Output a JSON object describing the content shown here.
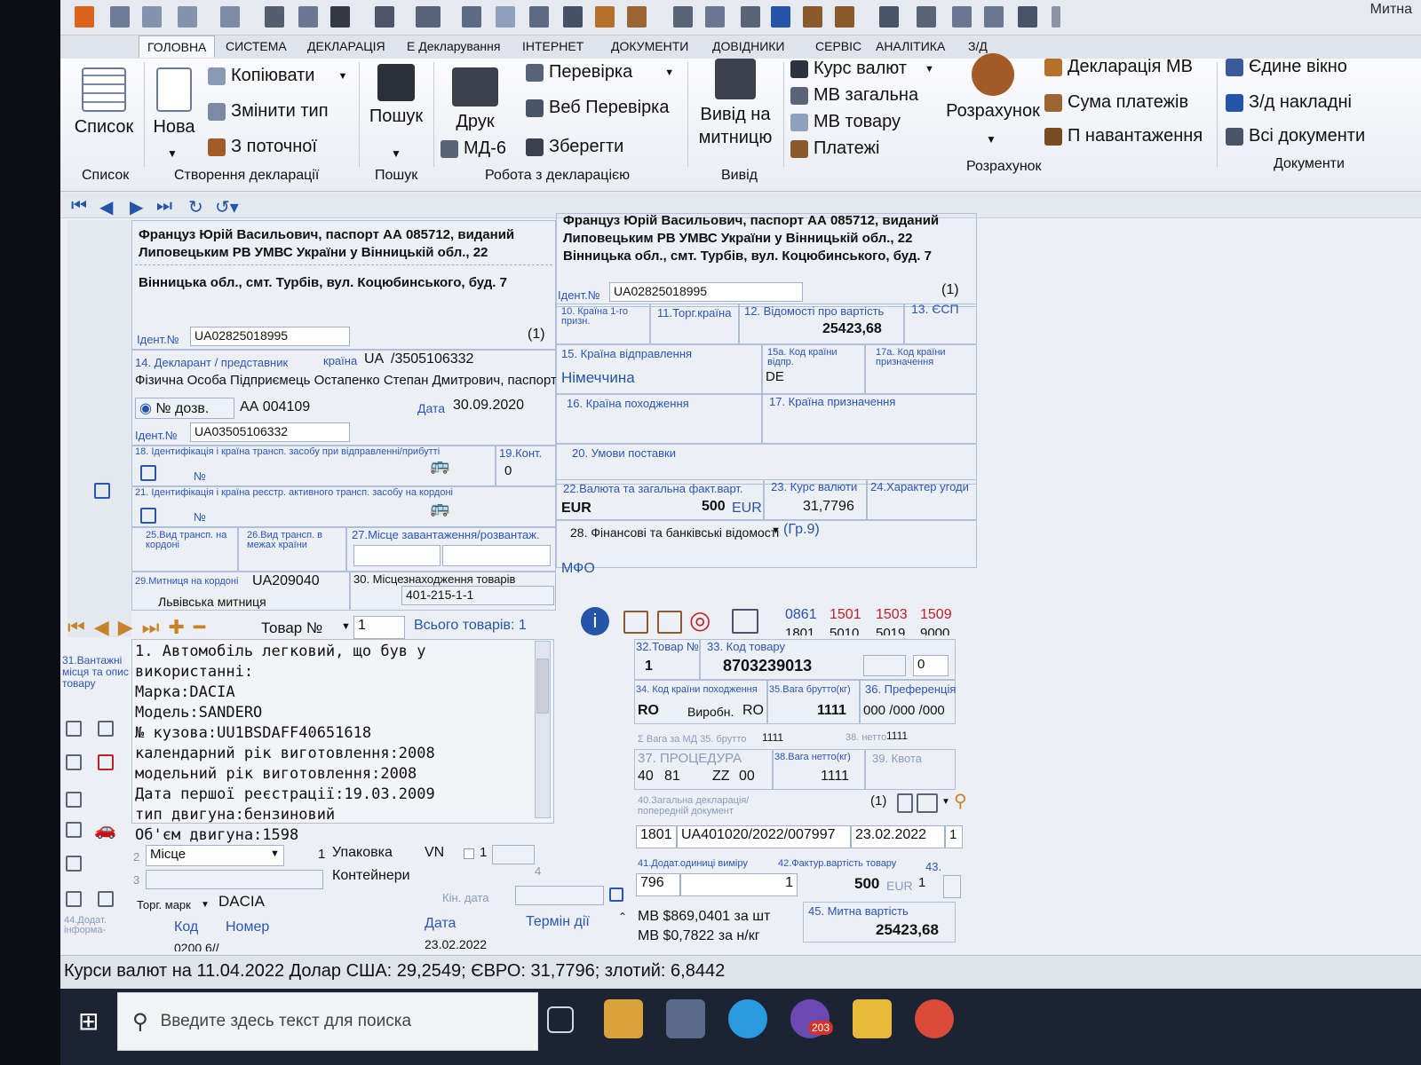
{
  "app": {
    "title": "Митна"
  },
  "menu": {
    "tabs": [
      "ГОЛОВНА",
      "СИСТЕМА",
      "ДЕКЛАРАЦІЯ",
      "Е Декларування",
      "ІНТЕРНЕТ",
      "ДОКУМЕНТИ",
      "ДОВІДНИКИ",
      "СЕРВІС",
      "АНАЛІТИКА",
      "З/Д"
    ]
  },
  "ribbon": {
    "list": {
      "button": "Список",
      "group": "Список"
    },
    "create": {
      "new": "Нова",
      "copy": "Копіювати",
      "change_type": "Змінити тип",
      "from_current": "З поточної",
      "group": "Створення декларації"
    },
    "search": {
      "button": "Пошук",
      "group": "Пошук"
    },
    "work": {
      "print": "Друк",
      "md6": "МД-6",
      "check": "Перевірка",
      "web_check": "Веб Перевірка",
      "save": "Зберегти",
      "group": "Робота з декларацією"
    },
    "output": {
      "button_line1": "Вивід на",
      "button_line2": "митницю",
      "group": "Вивід"
    },
    "calc": {
      "rates": "Курс валют",
      "mv_total": "МВ загальна",
      "mv_goods": "МВ товару",
      "payments": "Платежі",
      "calc_button": "Розрахунок",
      "decl_mv": "Декларація МВ",
      "sum_payments": "Сума платежів",
      "p_load": "П навантаження",
      "group": "Розрахунок"
    },
    "docs": {
      "single_window": "Єдине вікно",
      "zd_invoices": "З/д накладні",
      "all_docs": "Всі документи",
      "group": "Документи"
    }
  },
  "form": {
    "left_party": {
      "line1": "Француз Юрій Васильович, паспорт АА 085712, виданий",
      "line2": "Липовецьким РВ УМВС України у Вінницькій обл., 22",
      "line3": "Вінницька обл., смт. Турбів, вул. Коцюбинського, буд. 7",
      "ident_label": "Ідент.№",
      "ident": "UA02825018995",
      "num": "(1)"
    },
    "right_party": {
      "line1": "Француз Юрій Васильович, паспорт АА 085712, виданий",
      "line2": "Липовецьким РВ УМВС України у Вінницькій обл., 22",
      "line3": "Вінницька обл., смт. Турбів, вул. Коцюбинського, буд. 7",
      "ident_label": "Ідент.№",
      "ident": "UA02825018995",
      "num": "(1)"
    },
    "f10": "10. Країна 1-го призн.",
    "f11": "11.Торг.країна",
    "f12": {
      "label": "12. Відомості про вартість",
      "value": "25423,68"
    },
    "f13": "13. ЄСП",
    "f14": {
      "label": "14. Декларант / представник",
      "country_label": "країна",
      "country": "UA",
      "code": "/3505106332",
      "text": "Фізична Особа Підприємець Остапенко Степан Дмитрович, паспорт",
      "perm_label": "№ дозв.",
      "perm": "АА 004109",
      "date_label": "Дата",
      "date": "30.09.2020",
      "ident_label": "Ідент.№",
      "ident": "UA03505106332"
    },
    "f15": {
      "label": "15. Країна відправлення",
      "value": "Німеччина"
    },
    "f15a": {
      "label": "15а. Код країни відпр.",
      "value": "DE"
    },
    "f17a": "17а. Код країни призначення",
    "f16": "16. Країна походження",
    "f17": "17. Країна призначення",
    "f18": {
      "label": "18. Ідентифікація і країна трансп. засобу при відправленні/прибутті",
      "no": "№"
    },
    "f19": {
      "label": "19.Конт.",
      "value": "0"
    },
    "f20": "20. Умови поставки",
    "f21": {
      "label": "21. Ідентифікація і країна реєстр. активного трансп. засобу на кордоні",
      "no": "№"
    },
    "f22": {
      "label": "22.Валюта та загальна факт.варт.",
      "currency": "EUR",
      "amount": "500",
      "unit": "EUR"
    },
    "f23": {
      "label": "23. Курс валюти",
      "value": "31,7796"
    },
    "f24": "24.Характер угоди",
    "f25": "25.Вид трансп. на кордоні",
    "f26": "26.Вид трансп. в межах країни",
    "f27": "27.Місце завантаження/розвантаж.",
    "f28": {
      "label": "28. Фінансові та банківські відомості",
      "gr": "(Гр.9)",
      "mfo": "МФО"
    },
    "f29": {
      "label": "29.Митниця на кордоні",
      "code": "UA209040",
      "name": "Львівська митниця"
    },
    "f30": {
      "label": "30. Місцезнаходження товарів",
      "value": "401-215-1-1"
    },
    "goods_nav": {
      "label": "Товар №",
      "value": "1",
      "total": "Всього товарів: 1"
    },
    "codes_top": {
      "c1": "0861",
      "c2": "1501",
      "c3": "1503",
      "c4": "1509",
      "c5": "1801",
      "c6": "5010",
      "c7": "5019",
      "c8": "9000"
    },
    "f31": {
      "label": "31.Вантажні місця та опис товару",
      "lines": [
        "1. Автомобіль легковий, що був у",
        "використанні:",
        "Марка:DACIA",
        "Модель:SANDERO",
        "№ кузова:UU1BSDAFF40651618",
        "календарний рік виготовлення:2008",
        "модельний рік виготовлення:2008",
        "Дата першої реєстрації:19.03.2009",
        "тип двигуна:бензиновий",
        "Об'єм двигуна:1598"
      ]
    },
    "pack": {
      "place": "Місце",
      "qty": "1",
      "pack_label": "Упаковка",
      "vn": "VN",
      "vn_qty": "1",
      "containers": "Контейнери",
      "n4": "4",
      "trade_mark_label": "Торг. марк",
      "trade_mark": "DACIA",
      "end_date": "Кін. дата"
    },
    "f44": {
      "label": "44.Додат. інформа-",
      "col_code": "Код",
      "col_num": "Номер",
      "col_date": "Дата",
      "col_term": "Термін дії",
      "row_code": "0200 6//",
      "row_date": "23.02.2022"
    },
    "f32": {
      "label": "32.Товар №",
      "value": "1"
    },
    "f33": {
      "label": "33. Код товару",
      "value": "8703239013",
      "extra": "0"
    },
    "f34": {
      "label": "34. Код країни походження",
      "value": "RO",
      "maker_label": "Виробн.",
      "maker": "RO"
    },
    "f35": {
      "label": "35.Вага брутто(кг)",
      "value": "1111"
    },
    "f36": {
      "label": "36. Преференція",
      "value": "000 /000 /000"
    },
    "sum_weight": {
      "label": "Σ Вага за МД  35. брутто",
      "brutto": "1111",
      "netto_label": "38. нетто",
      "netto": "1111"
    },
    "f37": {
      "label": "37. ПРОЦЕДУРА",
      "v1": "40",
      "v2": "81",
      "v3": "ZZ",
      "v4": "00"
    },
    "f38": {
      "label": "38.Вага нетто(кг)",
      "value": "1111"
    },
    "f39": "39. Квота",
    "f40": {
      "label": "40.Загальна декларація/ попередній документ",
      "count": "(1)",
      "code": "1801",
      "doc": "UA401020/2022/007997",
      "date": "23.02.2022",
      "n": "1"
    },
    "f41": {
      "label": "41.Додат.одиниці виміру",
      "code": "796",
      "value": "1"
    },
    "f42": {
      "label": "42.Фактур.вартість товару",
      "value": "500",
      "unit": "EUR",
      "n": "1"
    },
    "f43": "43.",
    "f45": {
      "label": "45. Митна вартість",
      "value": "25423,68",
      "mv1": "МВ $869,0401 за шт",
      "mv2": "МВ $0,7822 за н/кг"
    }
  },
  "status": {
    "text": "Курси валют на 11.04.2022  Долар США: 29,2549; ЄВРО: 31,7796; злотий: 6,8442"
  },
  "taskbar": {
    "search_placeholder": "Введите здесь текст для поиска",
    "badge": "203"
  }
}
